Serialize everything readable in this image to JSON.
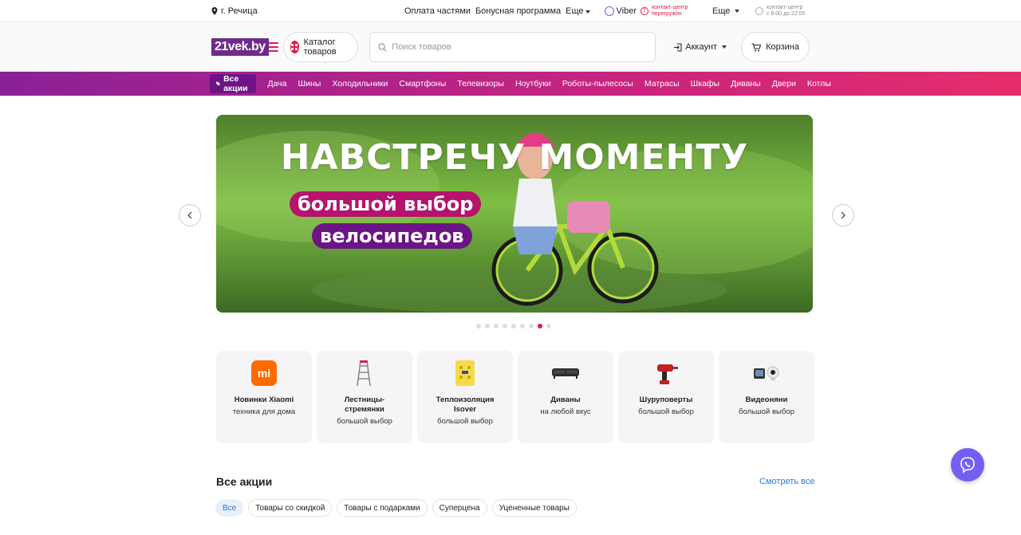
{
  "topbar": {
    "location": "г. Речица",
    "links": [
      "Оплата частями",
      "Бонусная программа",
      "Еще"
    ],
    "viber": "Viber",
    "contact_warning_line1": "контакт-центр",
    "contact_warning_line2": "перегружен",
    "more": "Еще",
    "hours_line1": "контакт-центр",
    "hours_line2": "с 8:00 до 22:00"
  },
  "header": {
    "logo": "21vek.by",
    "catalog_label": "Каталог товаров",
    "search_placeholder": "Поиск товаров",
    "account_label": "Аккаунт",
    "cart_label": "Корзина"
  },
  "nav": {
    "promo": "Все акции",
    "items": [
      "Дача",
      "Шины",
      "Холодильники",
      "Смартфоны",
      "Телевизоры",
      "Ноутбуки",
      "Роботы-пылесосы",
      "Матрасы",
      "Шкафы",
      "Диваны",
      "Двери",
      "Котлы"
    ]
  },
  "banner": {
    "headline": "НАВСТРЕЧУ МОМЕНТУ",
    "line1": "большой выбор",
    "line2": "велосипедов",
    "slide_count": 9,
    "active_slide": 8
  },
  "categories": [
    {
      "title": "Новинки Xiaomi",
      "sub": "техника для дома",
      "icon": "xiaomi-logo-icon",
      "logo_text": "mi"
    },
    {
      "title": "Лестницы-стремянки",
      "sub": "большой выбор",
      "icon": "ladder-icon"
    },
    {
      "title": "Теплоизоляция Isover",
      "sub": "большой выбор",
      "icon": "insulation-icon"
    },
    {
      "title": "Диваны",
      "sub": "на любой вкус",
      "icon": "sofa-icon"
    },
    {
      "title": "Шуруповерты",
      "sub": "большой выбор",
      "icon": "drill-icon"
    },
    {
      "title": "Видеоняни",
      "sub": "большой выбор",
      "icon": "baby-monitor-icon"
    }
  ],
  "promos": {
    "title": "Все акции",
    "see_all": "Смотреть все",
    "chips": [
      "Все",
      "Товары со скидкой",
      "Товары с подарками",
      "Суперцена",
      "Уцененные товары"
    ]
  },
  "colors": {
    "brand": "#e6194a",
    "purple": "#6e2b8b",
    "viber": "#7360f2",
    "link": "#2a7ad0"
  }
}
